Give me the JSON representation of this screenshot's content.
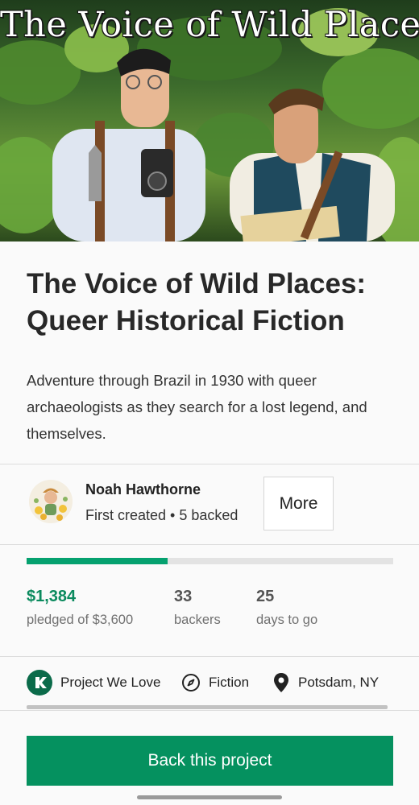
{
  "hero": {
    "image_title": "The Voice of Wild Places"
  },
  "project": {
    "title": "The Voice of Wild Places: Queer Historical Fiction",
    "blurb": "Adventure through Brazil in 1930 with queer archaeologists as they search for a lost legend, and themselves."
  },
  "creator": {
    "name": "Noah Hawthorne",
    "meta": "First created • 5 backed",
    "more_label": "More"
  },
  "funding": {
    "progress_fraction": 0.384,
    "pledged": "$1,384",
    "pledged_label": "pledged of $3,600",
    "backers": "33",
    "backers_label": "backers",
    "days": "25",
    "days_label": "days to go"
  },
  "tags": [
    {
      "label": "Project We Love",
      "icon": "kickstarter-badge-icon"
    },
    {
      "label": "Fiction",
      "icon": "compass-icon"
    },
    {
      "label": "Potsdam, NY",
      "icon": "location-pin-icon"
    }
  ],
  "cta": {
    "back_label": "Back this project"
  },
  "colors": {
    "accent": "#05915f",
    "progress": "#05a16f",
    "pledged_text": "#0b8a5e"
  }
}
